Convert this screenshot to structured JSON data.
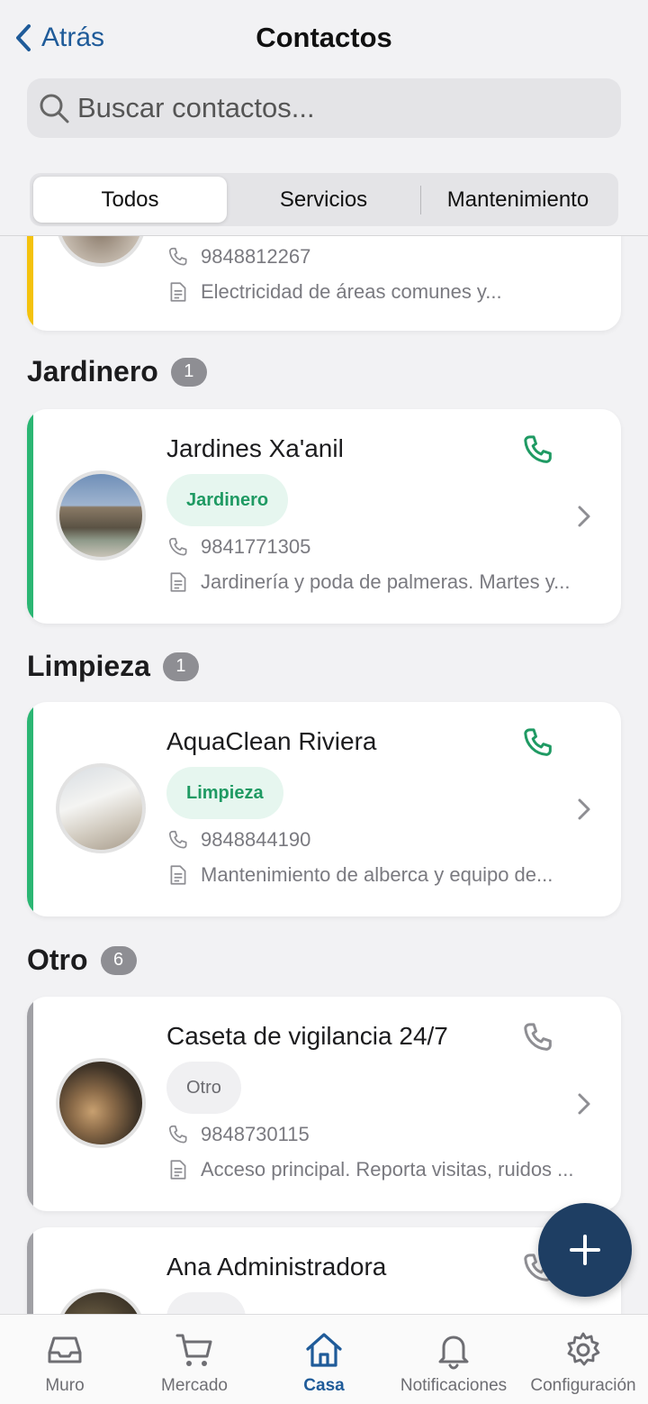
{
  "header": {
    "back_label": "Atrás",
    "title": "Contactos",
    "search_placeholder": "Buscar contactos..."
  },
  "segments": [
    "Todos",
    "Servicios",
    "Mantenimiento"
  ],
  "segments_active": "Todos",
  "partial_card": {
    "phone": "9848812267",
    "note": "Electricidad de áreas comunes y...",
    "accent": "#f4c20d"
  },
  "sections": [
    {
      "title": "Jardinero",
      "count": "1",
      "card": {
        "name": "Jardines Xa'anil",
        "tag": "Jardinero",
        "phone": "9841771305",
        "note": "Jardinería y poda de palmeras. Martes y...",
        "accent": "#2bb673"
      }
    },
    {
      "title": "Limpieza",
      "count": "1",
      "card": {
        "name": "AquaClean Riviera",
        "tag": "Limpieza",
        "phone": "9848844190",
        "note": "Mantenimiento de alberca y equipo de...",
        "accent": "#2bb673"
      }
    },
    {
      "title": "Otro",
      "count": "6",
      "card": {
        "name": "Caseta de vigilancia 24/7",
        "tag": "Otro",
        "phone": "9848730115",
        "note": "Acceso principal. Reporta visitas, ruidos ...",
        "accent": "#a0a0a5"
      }
    }
  ],
  "partial_bottom_card": {
    "name": "Ana Administradora",
    "accent": "#a0a0a5"
  },
  "tabbar": [
    {
      "label": "Muro",
      "icon": "inbox-icon"
    },
    {
      "label": "Mercado",
      "icon": "cart-icon"
    },
    {
      "label": "Casa",
      "icon": "home-icon"
    },
    {
      "label": "Notificaciones",
      "icon": "bell-icon"
    },
    {
      "label": "Configuración",
      "icon": "gear-icon"
    }
  ],
  "tabbar_active": "Casa",
  "colors": {
    "primary": "#1f5b99",
    "fab": "#1e3e63",
    "call_green": "#1f9a63",
    "call_gray": "#8e8e93"
  }
}
